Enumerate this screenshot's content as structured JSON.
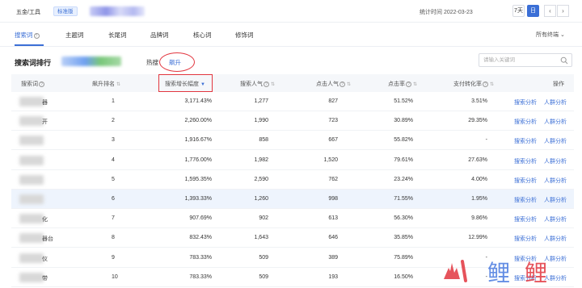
{
  "topbar": {
    "breadcrumb": "五金/工具",
    "edition_badge": "标准版",
    "stat_time": "统计时间 2022-03-23",
    "period_options": [
      "7天",
      "日"
    ],
    "active_period": "日",
    "prev_icon": "chevron-left-icon",
    "next_icon": "chevron-right-icon"
  },
  "tabs": {
    "items": [
      "搜索词",
      "主题词",
      "长尾词",
      "品牌词",
      "核心词",
      "修饰词"
    ],
    "active": "搜索词",
    "terminal_select": "所有终端"
  },
  "section": {
    "title": "搜索词排行",
    "segments": [
      "热搜",
      "飙升"
    ],
    "active_segment": "飙升",
    "search_placeholder": "请输入关键词"
  },
  "table": {
    "headers": {
      "keyword": "搜索词",
      "rank": "飙升排名",
      "growth": "搜索增长幅度",
      "search_pop": "搜索人气",
      "click_pop": "点击人气",
      "ctr": "点击率",
      "cvr": "支付转化率",
      "action": "操作"
    },
    "rows": [
      {
        "kw_tail": "器",
        "rank": "1",
        "growth": "3,171.43%",
        "search_pop": "1,277",
        "click_pop": "827",
        "ctr": "51.52%",
        "cvr": "3.51%"
      },
      {
        "kw_tail": "开",
        "rank": "2",
        "growth": "2,260.00%",
        "search_pop": "1,990",
        "click_pop": "723",
        "ctr": "30.89%",
        "cvr": "29.35%"
      },
      {
        "kw_tail": "",
        "rank": "3",
        "growth": "1,916.67%",
        "search_pop": "858",
        "click_pop": "667",
        "ctr": "55.82%",
        "cvr": "-"
      },
      {
        "kw_tail": "",
        "rank": "4",
        "growth": "1,776.00%",
        "search_pop": "1,982",
        "click_pop": "1,520",
        "ctr": "79.61%",
        "cvr": "27.63%"
      },
      {
        "kw_tail": "",
        "rank": "5",
        "growth": "1,595.35%",
        "search_pop": "2,590",
        "click_pop": "762",
        "ctr": "23.24%",
        "cvr": "4.00%"
      },
      {
        "kw_tail": "",
        "rank": "6",
        "growth": "1,393.33%",
        "search_pop": "1,260",
        "click_pop": "998",
        "ctr": "71.55%",
        "cvr": "1.95%"
      },
      {
        "kw_tail": "化",
        "rank": "7",
        "growth": "907.69%",
        "search_pop": "902",
        "click_pop": "613",
        "ctr": "56.30%",
        "cvr": "9.86%"
      },
      {
        "kw_tail": "器台",
        "rank": "8",
        "growth": "832.43%",
        "search_pop": "1,643",
        "click_pop": "646",
        "ctr": "35.85%",
        "cvr": "12.99%"
      },
      {
        "kw_tail": "仪",
        "rank": "9",
        "growth": "783.33%",
        "search_pop": "509",
        "click_pop": "389",
        "ctr": "75.89%",
        "cvr": "-"
      },
      {
        "kw_tail": "带",
        "rank": "10",
        "growth": "783.33%",
        "search_pop": "509",
        "click_pop": "193",
        "ctr": "16.50%",
        "cvr": "-"
      }
    ],
    "action_links": [
      "搜索分析",
      "人群分析"
    ]
  },
  "watermark": {
    "text": "鲤",
    "colors": {
      "red": "#e2363f",
      "blue": "#4a7be0"
    }
  },
  "colors": {
    "accent": "#3b6fd6",
    "annotation": "#e2363f"
  }
}
